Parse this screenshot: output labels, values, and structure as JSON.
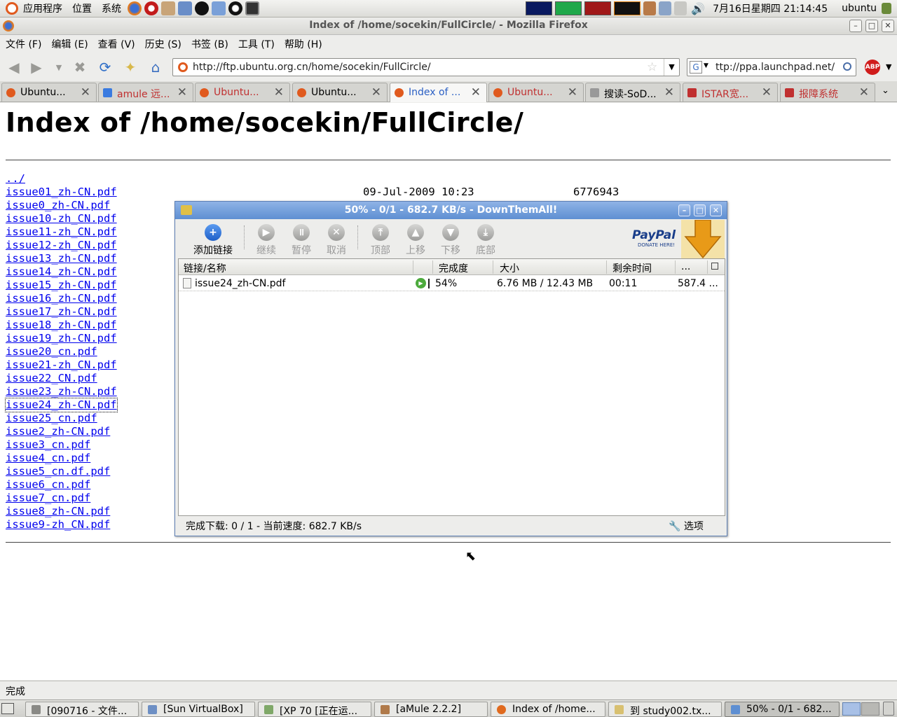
{
  "panel": {
    "apps": "应用程序",
    "places": "位置",
    "system": "系统",
    "clock": "7月16日星期四 21:14:45",
    "user": "ubuntu"
  },
  "window": {
    "title": "Index of /home/socekin/FullCircle/ - Mozilla Firefox"
  },
  "menubar": [
    "文件 (F)",
    "编辑 (E)",
    "查看 (V)",
    "历史 (S)",
    "书签 (B)",
    "工具 (T)",
    "帮助 (H)"
  ],
  "navbar": {
    "url": "http://ftp.ubuntu.org.cn/home/socekin/FullCircle/",
    "search": "ttp://ppa.launchpad.net/",
    "abp": "ABP"
  },
  "tabs": [
    {
      "label": "Ubuntu...",
      "color": "#e05a1e"
    },
    {
      "label": "amule 远...",
      "color": "#3a7be0"
    },
    {
      "label": "Ubuntu...",
      "color": "#e05a1e"
    },
    {
      "label": "Ubuntu...",
      "color": "#e05a1e"
    },
    {
      "label": "Index of ...",
      "color": "#e05a1e"
    },
    {
      "label": "Ubuntu...",
      "color": "#e05a1e"
    },
    {
      "label": "搜读-SoD...",
      "color": "#888888"
    },
    {
      "label": "ISTAR宽...",
      "color": "#c03030"
    },
    {
      "label": "报障系统",
      "color": "#c03030"
    }
  ],
  "page": {
    "heading": "Index of /home/socekin/FullCircle/",
    "parent_link": "../",
    "first_date": "09-Jul-2009 10:23",
    "first_size": "6776943",
    "files": [
      "issue01_zh-CN.pdf",
      "issue0_zh-CN.pdf",
      "issue10-zh_CN.pdf",
      "issue11-zh_CN.pdf",
      "issue12-zh_CN.pdf",
      "issue13_zh-CN.pdf",
      "issue14_zh-CN.pdf",
      "issue15_zh-CN.pdf",
      "issue16_zh-CN.pdf",
      "issue17_zh-CN.pdf",
      "issue18_zh-CN.pdf",
      "issue19_zh-CN.pdf",
      "issue20_cn.pdf",
      "issue21-zh_CN.pdf",
      "issue22_CN.pdf",
      "issue23_zh-CN.pdf",
      "issue24_zh-CN.pdf",
      "issue25_cn.pdf",
      "issue2_zh-CN.pdf",
      "issue3_cn.pdf",
      "issue4_cn.pdf",
      "issue5_cn.df.pdf",
      "issue6_cn.pdf",
      "issue7_cn.pdf",
      "issue8_zh-CN.pdf",
      "issue9-zh_CN.pdf"
    ]
  },
  "dta": {
    "title": "50% - 0/1 - 682.7 KB/s - DownThemAll!",
    "tools": [
      "添加链接",
      "继续",
      "暂停",
      "取消",
      "顶部",
      "上移",
      "下移",
      "底部"
    ],
    "paypal": "PayPal",
    "paypal_sub": "DONATE HERE!",
    "columns": [
      "链接/名称",
      "完成度",
      "大小",
      "剩余时间",
      "..."
    ],
    "row": {
      "name": "issue24_zh-CN.pdf",
      "progress_text": "54%",
      "progress": 0.54,
      "size": "6.76 MB / 12.43 MB",
      "remaining": "00:11",
      "speed": "587.4 ..."
    },
    "status": "完成下载: 0 / 1 - 当前速度: 682.7 KB/s",
    "options": "选项"
  },
  "statusbar": "完成",
  "taskbar": [
    {
      "label": "[090716 - 文件...",
      "color": "#8a8a86"
    },
    {
      "label": "[Sun VirtualBox]",
      "color": "#6d8fc4"
    },
    {
      "label": "[XP 70 [正在运...",
      "color": "#7fa868"
    },
    {
      "label": "[aMule 2.2.2]",
      "color": "#b07a4a"
    },
    {
      "label": "Index of /home...",
      "color": "#e06a1e"
    },
    {
      "label": "到 study002.tx...",
      "color": "#d8c070"
    },
    {
      "label": "50% - 0/1 - 682...",
      "color": "#5e8fd2"
    }
  ]
}
